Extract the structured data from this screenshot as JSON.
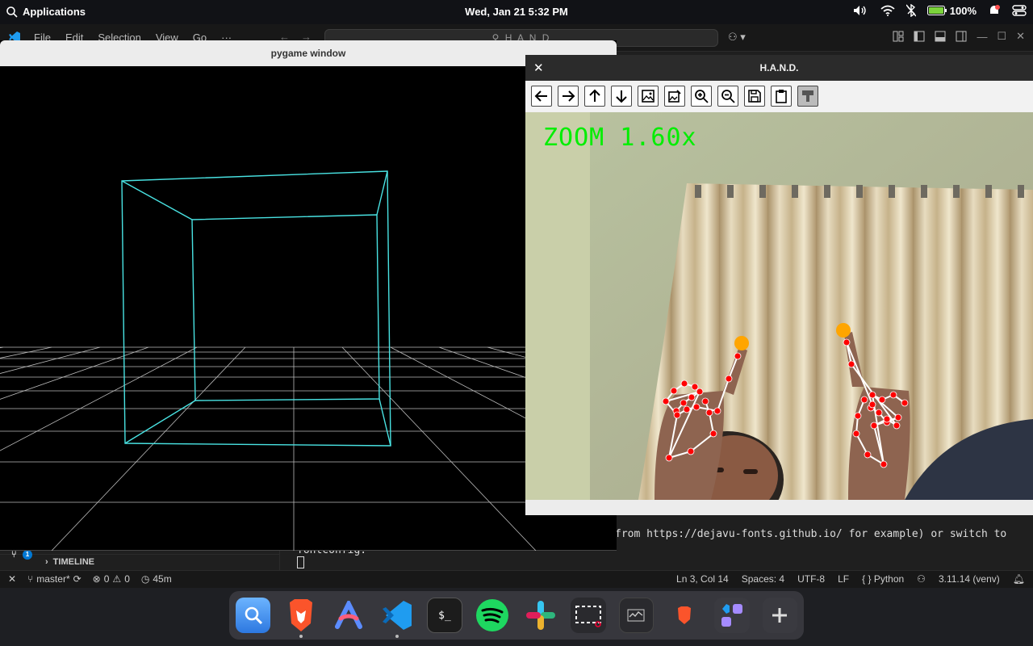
{
  "topbar": {
    "apps_label": "Applications",
    "clock": "Wed, Jan 21   5:32 PM",
    "battery": "100%"
  },
  "vscode": {
    "menus": [
      "File",
      "Edit",
      "Selection",
      "View",
      "Go",
      "···"
    ],
    "search": "H A N D",
    "terminal_line1": "from https://dejavu-fonts.github.io/ for example) or switch to",
    "terminal_line2": "fontconfig.",
    "timeline_label": "TIMELINE",
    "source_control_badge": "1",
    "status": {
      "branch": "master*",
      "errors": "0",
      "warnings": "0",
      "time": "45m",
      "position": "Ln 3, Col 14",
      "spaces": "Spaces: 4",
      "encoding": "UTF-8",
      "eol": "LF",
      "language": "Python",
      "interpreter": "3.11.14 (venv)"
    }
  },
  "pygame_window": {
    "title": "pygame window",
    "wire_color": "#49e3e3",
    "grid_color": "#bbbbbb"
  },
  "hand_window": {
    "title": "H.A.N.D.",
    "zoom_text": "ZOOM 1.60x",
    "toolbar_icons": [
      "arrow-left-icon",
      "arrow-right-icon",
      "arrow-up-icon",
      "arrow-down-icon",
      "image-icon",
      "image-edit-icon",
      "zoom-in-icon",
      "zoom-out-icon",
      "save-icon",
      "clipboard-icon",
      "settings-icon"
    ],
    "tracker_color": "#ffa500",
    "landmark_color": "#ff0000"
  },
  "dock": {
    "apps": [
      "finder-icon",
      "brave-browser-icon",
      "arc-icon",
      "vscode-icon",
      "terminal-icon",
      "spotify-icon",
      "slack-icon",
      "screenshot-icon",
      "activity-monitor-icon",
      "brave-private-icon",
      "vscode-windows-icon",
      "add-icon"
    ]
  }
}
